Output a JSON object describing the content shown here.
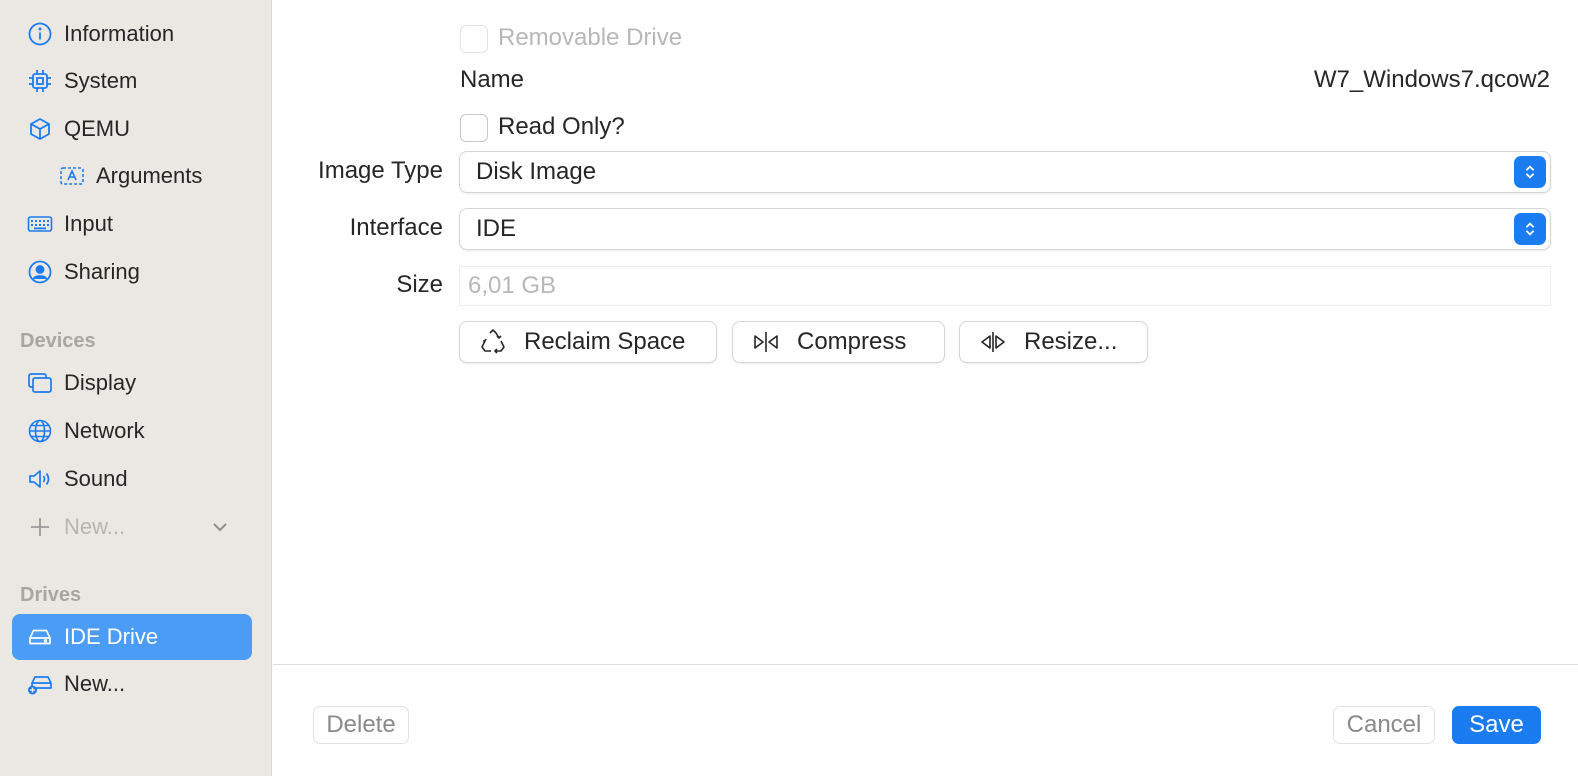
{
  "sidebar": {
    "items": [
      {
        "label": "Information",
        "icon": "info-icon"
      },
      {
        "label": "System",
        "icon": "cpu-icon"
      },
      {
        "label": "QEMU",
        "icon": "cube-icon"
      },
      {
        "label": "Arguments",
        "icon": "text-box-icon"
      },
      {
        "label": "Input",
        "icon": "keyboard-icon"
      },
      {
        "label": "Sharing",
        "icon": "person-circle-icon"
      }
    ],
    "devices_header": "Devices",
    "devices": [
      {
        "label": "Display",
        "icon": "display-icon"
      },
      {
        "label": "Network",
        "icon": "globe-icon"
      },
      {
        "label": "Sound",
        "icon": "speaker-icon"
      }
    ],
    "new_device_label": "New...",
    "drives_header": "Drives",
    "drives": [
      {
        "label": "IDE Drive",
        "icon": "drive-icon",
        "selected": true
      }
    ],
    "new_drive_label": "New..."
  },
  "form": {
    "removable_label": "Removable Drive",
    "name_label": "Name",
    "name_value": "W7_Windows7.qcow2",
    "readonly_label": "Read Only?",
    "image_type_label": "Image Type",
    "image_type_value": "Disk Image",
    "interface_label": "Interface",
    "interface_value": "IDE",
    "size_label": "Size",
    "size_placeholder": "6,01 GB",
    "reclaim_label": "Reclaim Space",
    "compress_label": "Compress",
    "resize_label": "Resize..."
  },
  "footer": {
    "delete_label": "Delete",
    "cancel_label": "Cancel",
    "save_label": "Save"
  },
  "colors": {
    "accent": "#1a7cf0",
    "selected_bg": "#4a9cf5",
    "sidebar_bg": "#ebe8e4"
  }
}
